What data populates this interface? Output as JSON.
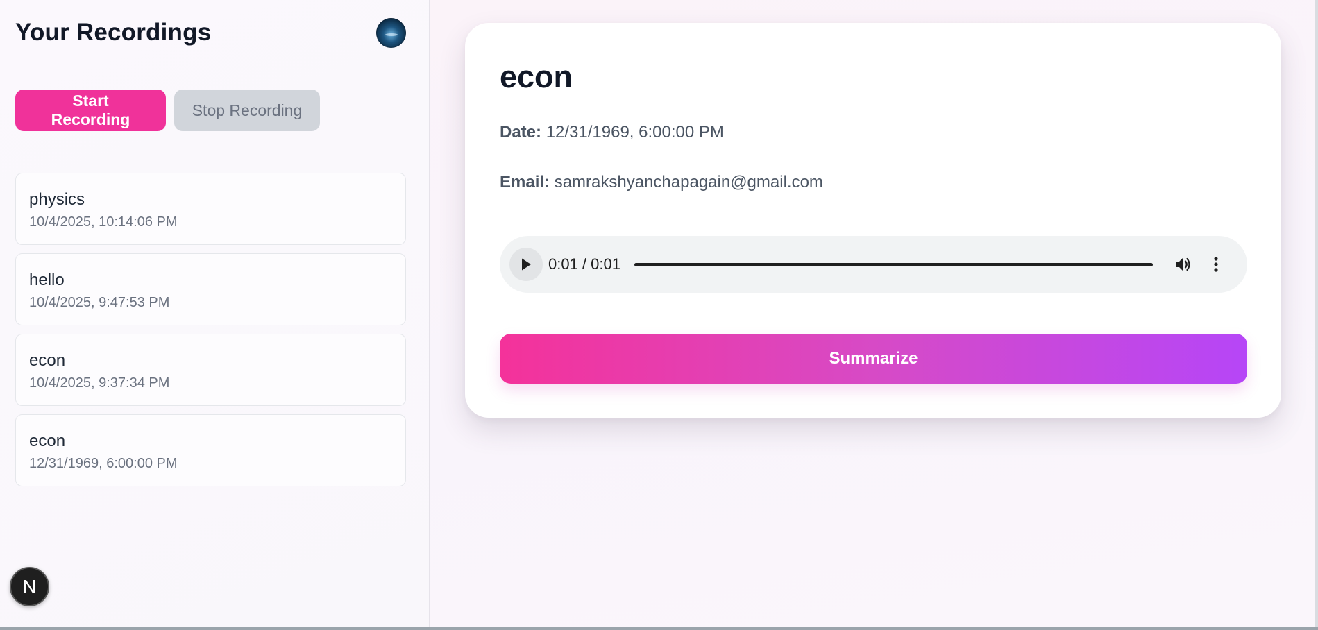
{
  "sidebar": {
    "title": "Your Recordings",
    "avatar_icon": "user-avatar",
    "start_label": "Start Recording",
    "stop_label": "Stop Recording",
    "recordings": [
      {
        "name": "physics",
        "date": "10/4/2025, 10:14:06 PM"
      },
      {
        "name": "hello",
        "date": "10/4/2025, 9:47:53 PM"
      },
      {
        "name": "econ",
        "date": "10/4/2025, 9:37:34 PM"
      },
      {
        "name": "econ",
        "date": "12/31/1969, 6:00:00 PM"
      }
    ],
    "badge_letter": "N"
  },
  "detail": {
    "title": "econ",
    "date_label": "Date:",
    "date_value": "12/31/1969, 6:00:00 PM",
    "email_label": "Email:",
    "email_value": "samrakshyanchapagain@gmail.com",
    "audio": {
      "time": "0:01 / 0:01",
      "progress": 1.0
    },
    "summarize_label": "Summarize"
  },
  "colors": {
    "accent_pink": "#f0329a",
    "accent_purple": "#b646f7",
    "stop_bg": "#d1d5db"
  }
}
